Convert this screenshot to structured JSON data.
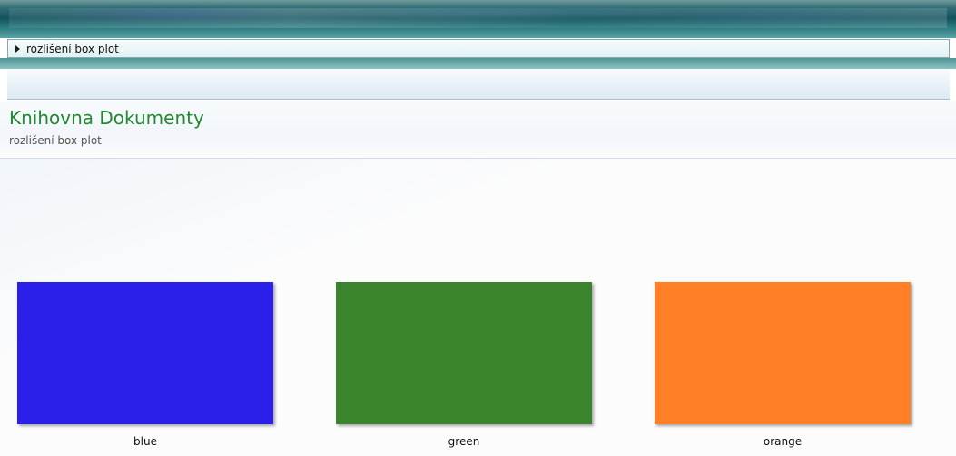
{
  "address_bar": {
    "path": "rozlišení box plot"
  },
  "library": {
    "title": "Knihovna Dokumenty",
    "subtitle": "rozlišení box plot"
  },
  "items": [
    {
      "label": "blue",
      "color": "#2b20e9"
    },
    {
      "label": "green",
      "color": "#3a842d"
    },
    {
      "label": "orange",
      "color": "#ff7f27"
    }
  ]
}
